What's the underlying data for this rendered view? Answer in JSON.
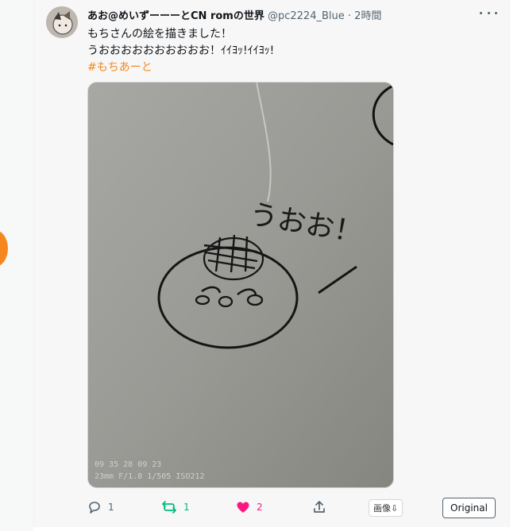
{
  "tweet": {
    "author_name": "あお@めいずーーーとCN romの世界",
    "handle": "@pc2224_Blue",
    "separator": "·",
    "time": "2時間",
    "lines": [
      "もちさんの絵を描きました！",
      "うおおおおおおおおおお！ｲｲﾖｯ!ｲｲﾖｯ!"
    ],
    "hashtag": "#もちあーと"
  },
  "media": {
    "handwritten_text": "うおお！",
    "photo_timestamp": "09 35 28 09 23",
    "photo_info": "23mm F/1.8 1/505 ISO212"
  },
  "actions": {
    "reply_count": "1",
    "retweet_count": "1",
    "like_count": "2",
    "image_button": "画像⇩",
    "original_button": "Original"
  },
  "colors": {
    "accent": "#f6871f",
    "retweet": "#00ba7c",
    "like": "#f91880",
    "muted": "#536471"
  },
  "icons": [
    "more-icon",
    "reply-icon",
    "retweet-icon",
    "like-icon",
    "share-icon"
  ]
}
